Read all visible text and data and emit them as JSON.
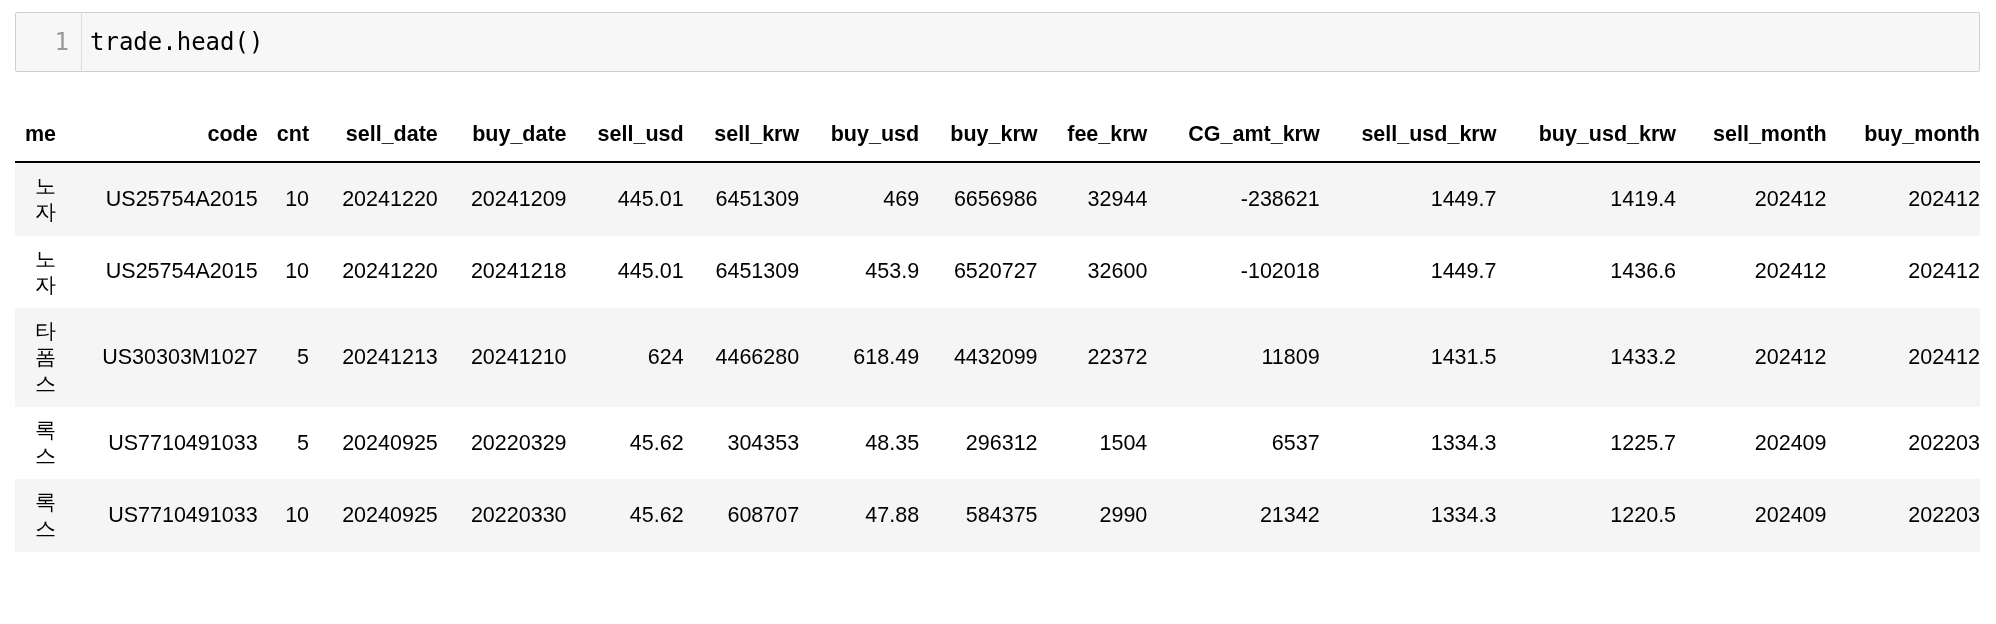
{
  "code_cell": {
    "line_number": "1",
    "code": "trade.head()"
  },
  "table": {
    "columns": [
      "me",
      "code",
      "cnt",
      "sell_date",
      "buy_date",
      "sell_usd",
      "sell_krw",
      "buy_usd",
      "buy_krw",
      "fee_krw",
      "CG_amt_krw",
      "sell_usd_krw",
      "buy_usd_krw",
      "sell_month",
      "buy_month"
    ],
    "rows": [
      [
        "노 자",
        "US25754A2015",
        "10",
        "20241220",
        "20241209",
        "445.01",
        "6451309",
        "469",
        "6656986",
        "32944",
        "-238621",
        "1449.7",
        "1419.4",
        "202412",
        "202412"
      ],
      [
        "노 자",
        "US25754A2015",
        "10",
        "20241220",
        "20241218",
        "445.01",
        "6451309",
        "453.9",
        "6520727",
        "32600",
        "-102018",
        "1449.7",
        "1436.6",
        "202412",
        "202412"
      ],
      [
        "타 폼 스",
        "US30303M1027",
        "5",
        "20241213",
        "20241210",
        "624",
        "4466280",
        "618.49",
        "4432099",
        "22372",
        "11809",
        "1431.5",
        "1433.2",
        "202412",
        "202412"
      ],
      [
        "록 스",
        "US7710491033",
        "5",
        "20240925",
        "20220329",
        "45.62",
        "304353",
        "48.35",
        "296312",
        "1504",
        "6537",
        "1334.3",
        "1225.7",
        "202409",
        "202203"
      ],
      [
        "록 스",
        "US7710491033",
        "10",
        "20240925",
        "20220330",
        "45.62",
        "608707",
        "47.88",
        "584375",
        "2990",
        "21342",
        "1334.3",
        "1220.5",
        "202409",
        "202203"
      ]
    ]
  }
}
